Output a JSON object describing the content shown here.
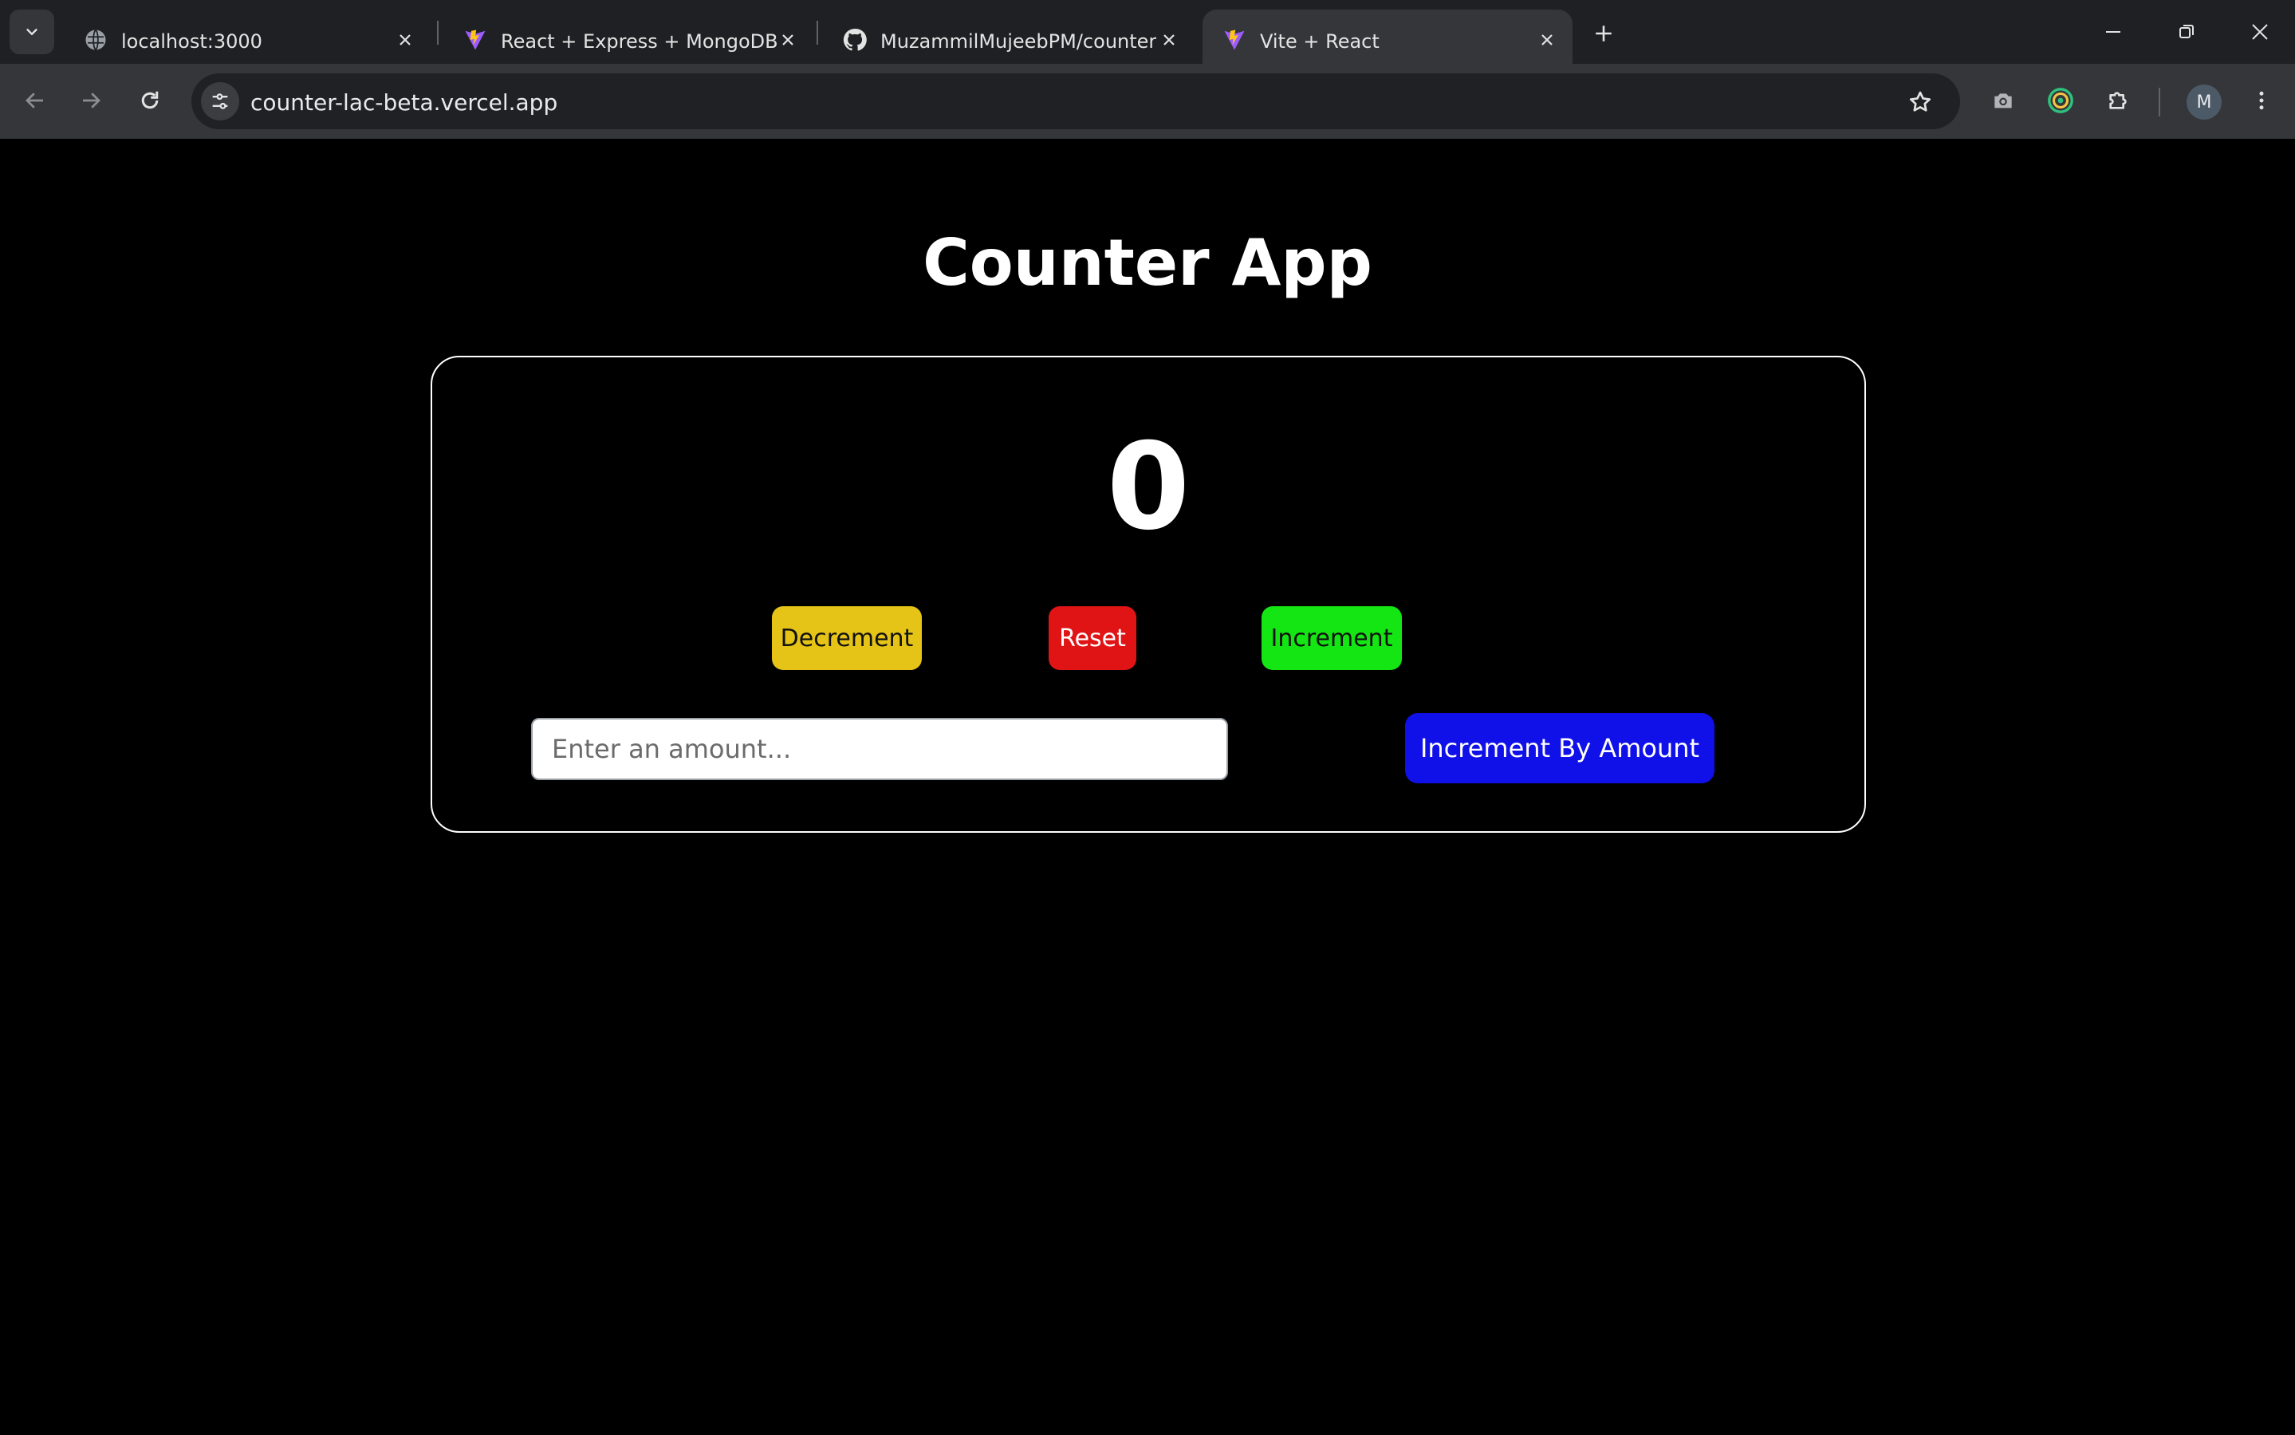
{
  "browser": {
    "tabs": [
      {
        "title": "localhost:3000",
        "icon": "globe-icon",
        "active": false
      },
      {
        "title": "React + Express + MongoDB",
        "icon": "vite-icon",
        "active": false
      },
      {
        "title": "MuzammilMujeebPM/counter",
        "icon": "github-icon",
        "active": false
      },
      {
        "title": "Vite + React",
        "icon": "vite-icon",
        "active": true
      }
    ],
    "url": "counter-lac-beta.vercel.app",
    "profile_initial": "M"
  },
  "app": {
    "title": "Counter App",
    "count": "0",
    "buttons": {
      "decrement": "Decrement",
      "reset": "Reset",
      "increment": "Increment",
      "increment_by_amount": "Increment By Amount"
    },
    "amount_input": {
      "placeholder": "Enter an amount...",
      "value": ""
    }
  },
  "colors": {
    "decrement": "#e6c417",
    "reset": "#e01414",
    "increment": "#14e614",
    "increment_by_amount": "#1010e8"
  }
}
